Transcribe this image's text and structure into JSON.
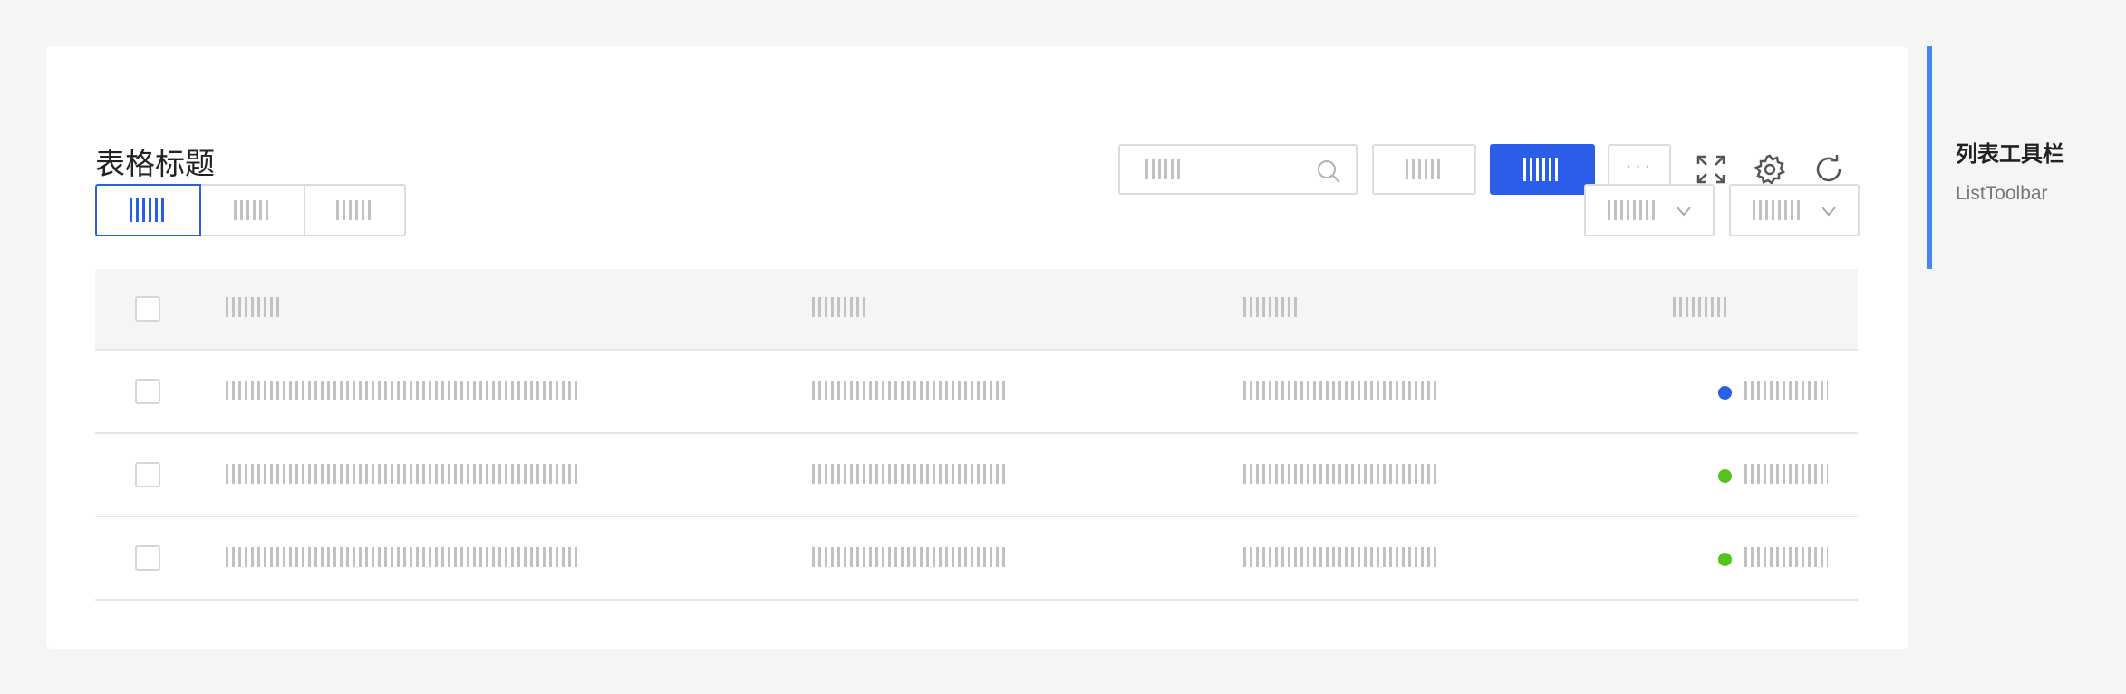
{
  "card": {
    "title": "表格标题"
  },
  "toolbar": {
    "search_icon": "search-icon",
    "more_label": "···",
    "icons": [
      "fullscreen-icon",
      "settings-icon",
      "refresh-icon"
    ]
  },
  "segments": {
    "active_index": 0,
    "count": 3
  },
  "dropdowns": [
    {
      "icon": "chevron-down-icon"
    },
    {
      "icon": "chevron-down-icon"
    }
  ],
  "table": {
    "rows": [
      {
        "status_color": "#2b5ee8"
      },
      {
        "status_color": "#52c41a"
      },
      {
        "status_color": "#52c41a"
      }
    ]
  },
  "side": {
    "title": "列表工具栏",
    "subtitle": "ListToolbar",
    "accent": "#4a86f0"
  },
  "colors": {
    "primary": "#2b5ee8",
    "success": "#52c41a",
    "background": "#f5f5f5"
  }
}
